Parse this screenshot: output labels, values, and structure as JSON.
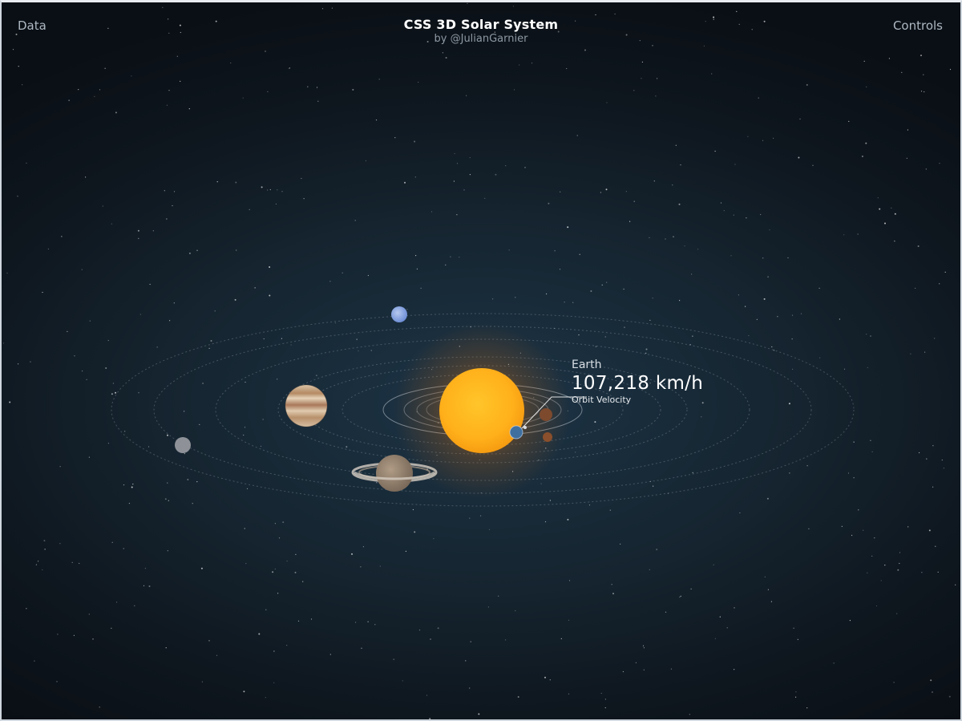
{
  "header": {
    "left_link": "Data",
    "right_link": "Controls",
    "title": "CSS 3D Solar System",
    "subtitle": "by @JulianGarnier"
  },
  "info": {
    "planet_name": "Earth",
    "value": "107,218 km/h",
    "label": "Orbit Velocity"
  },
  "colors": {
    "sun": "#ffb21c",
    "background": "#15242f",
    "orbit": "#9aa6b2"
  }
}
